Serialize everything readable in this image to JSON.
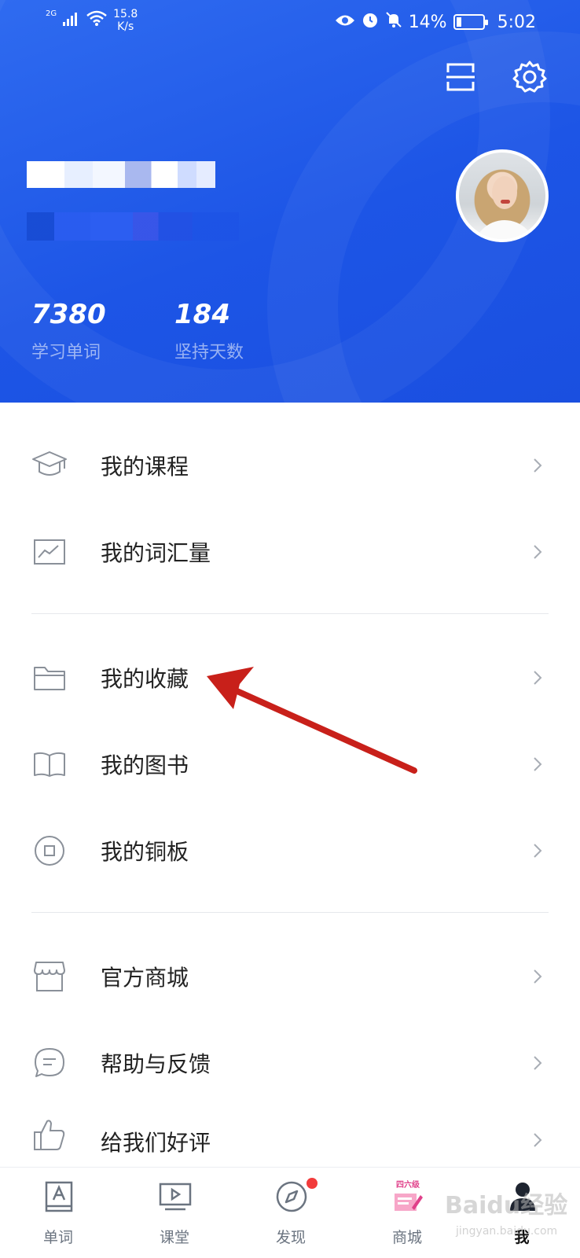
{
  "status_bar": {
    "network": "2G",
    "speed_value": "15.8",
    "speed_unit": "K/s",
    "battery": "14%",
    "time": "5:02"
  },
  "header": {
    "icons": [
      "scan-icon",
      "settings-icon"
    ],
    "stats": [
      {
        "value": "7380",
        "label": "学习单词"
      },
      {
        "value": "184",
        "label": "坚持天数"
      }
    ]
  },
  "menu": {
    "group1": [
      {
        "label": "我的课程",
        "icon": "graduation-cap-icon"
      },
      {
        "label": "我的词汇量",
        "icon": "chart-icon"
      }
    ],
    "group2": [
      {
        "label": "我的收藏",
        "icon": "folder-icon"
      },
      {
        "label": "我的图书",
        "icon": "book-icon"
      },
      {
        "label": "我的铜板",
        "icon": "coin-icon"
      }
    ],
    "group3": [
      {
        "label": "官方商城",
        "icon": "store-icon"
      },
      {
        "label": "帮助与反馈",
        "icon": "chat-icon"
      },
      {
        "label": "给我们好评",
        "icon": "thumbs-up-icon"
      }
    ]
  },
  "bottom_nav": [
    {
      "label": "单词",
      "icon": "word-book-icon"
    },
    {
      "label": "课堂",
      "icon": "video-class-icon"
    },
    {
      "label": "发现",
      "icon": "compass-icon"
    },
    {
      "label": "商城",
      "icon": "mall-cet-icon",
      "badge_text": "四六级"
    },
    {
      "label": "我",
      "icon": "profile-icon",
      "active": true
    }
  ],
  "colors": {
    "header_blue": "#1d55e6",
    "badge_red": "#f23b3b",
    "annotation_red": "#c8201a"
  },
  "watermark": "Baidu经验",
  "watermark_sub": "jingyan.baidu.com"
}
